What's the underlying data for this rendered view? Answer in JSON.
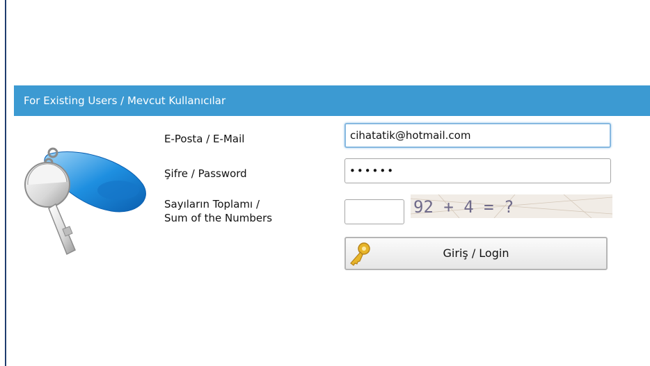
{
  "panel": {
    "title": "For Existing Users / Mevcut Kullanıcılar"
  },
  "form": {
    "email_label": "E-Posta / E-Mail",
    "email_value": "cihatatik@hotmail.com",
    "password_label": "Şifre / Password",
    "password_value": "••••••",
    "sum_label_line1": "Sayıların Toplamı /",
    "sum_label_line2": "Sum of the Numbers",
    "sum_value": "",
    "captcha_text": "92 + 4 = ?",
    "login_label": "Giriş / Login"
  },
  "icons": {
    "key_art": "key-illustration-icon",
    "login": "key-icon"
  },
  "colors": {
    "header_bg": "#3c9ad2",
    "header_text": "#ffffff",
    "focus_border": "#86b8e0"
  }
}
